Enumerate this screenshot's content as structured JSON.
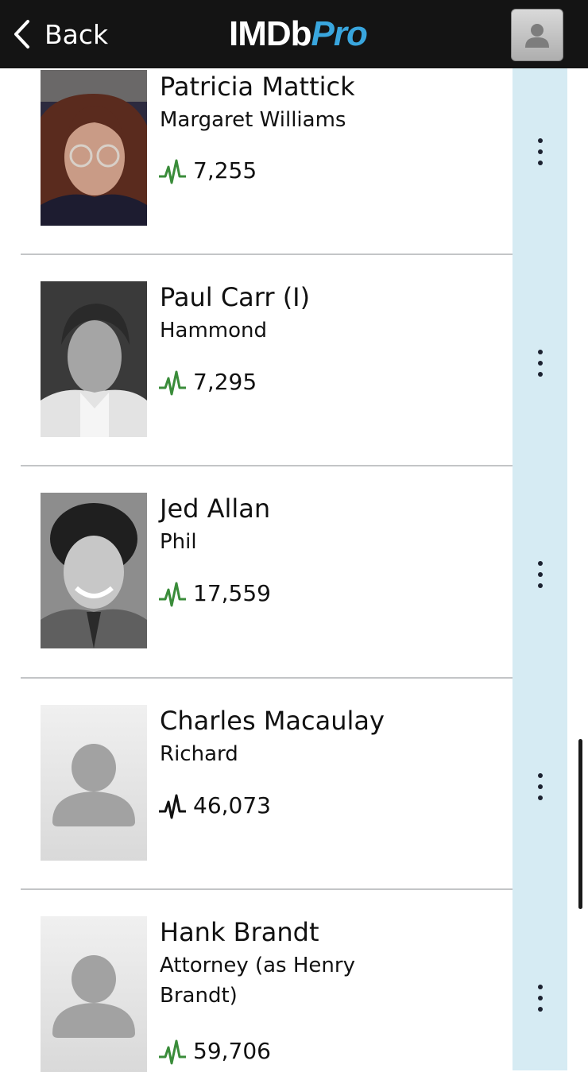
{
  "header": {
    "back_label": "Back",
    "logo_imdb": "IMDb",
    "logo_pro": "Pro"
  },
  "cast": [
    {
      "name": "Patricia Mattick",
      "role": "Margaret Williams",
      "starmeter": "7,255",
      "trend": "up",
      "photo": "portrait"
    },
    {
      "name": "Paul Carr (I)",
      "role": "Hammond",
      "starmeter": "7,295",
      "trend": "up",
      "photo": "portrait"
    },
    {
      "name": "Jed Allan",
      "role": "Phil",
      "starmeter": "17,559",
      "trend": "up",
      "photo": "portrait"
    },
    {
      "name": "Charles Macaulay",
      "role": "Richard",
      "starmeter": "46,073",
      "trend": "down",
      "photo": "placeholder"
    },
    {
      "name": "Hank Brandt",
      "role": "Attorney (as Henry Brandt)",
      "starmeter": "59,706",
      "trend": "up",
      "photo": "placeholder"
    }
  ],
  "colors": {
    "header_bg": "#141414",
    "pro_accent": "#39a6de",
    "trend_up": "#3a8c3a",
    "trend_down": "#111111",
    "action_column": "#d6ebf3"
  }
}
